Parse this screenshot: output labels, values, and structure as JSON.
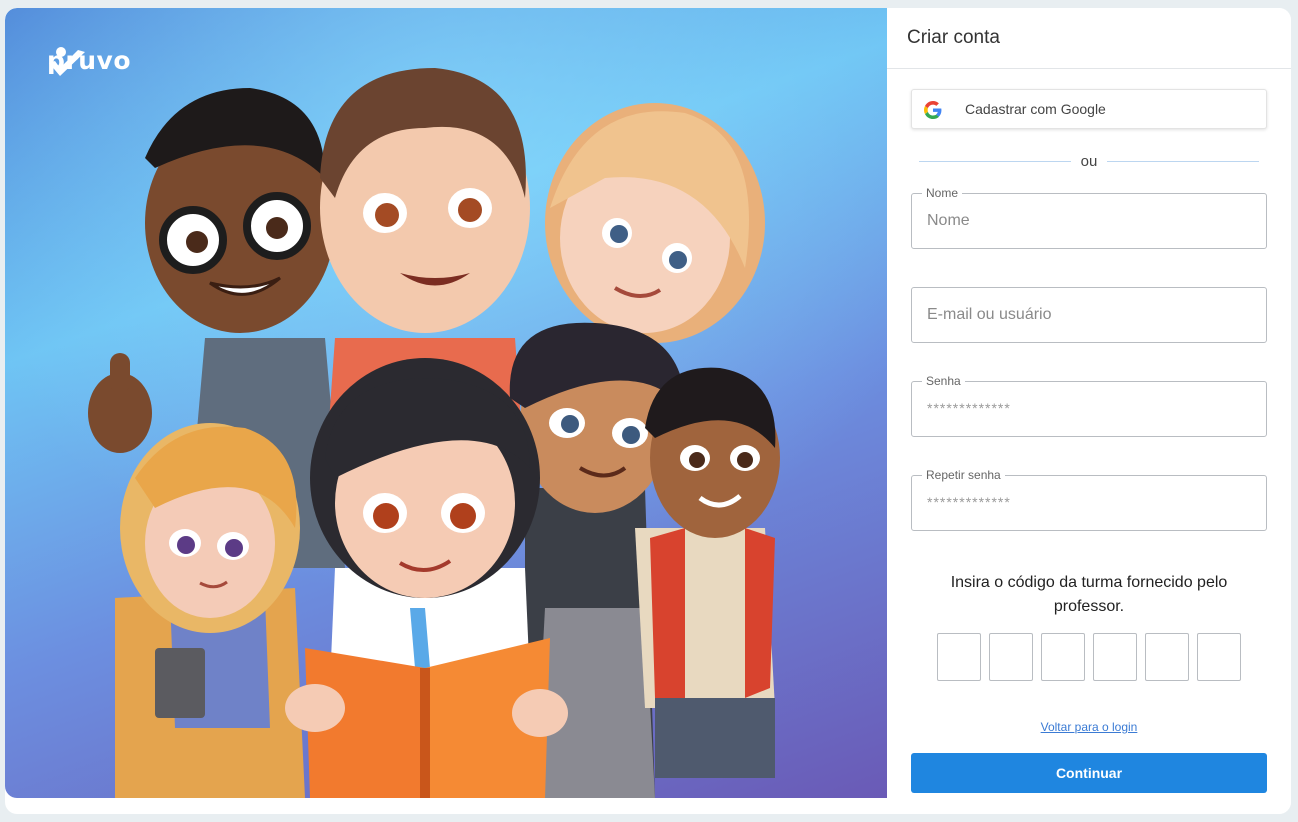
{
  "brand": {
    "name": "pruvo"
  },
  "panel": {
    "title": "Criar conta",
    "google_label": "Cadastrar com Google",
    "divider_text": "ou",
    "fields": {
      "name": {
        "legend": "Nome",
        "placeholder": "Nome"
      },
      "email": {
        "placeholder": "E-mail ou usuário"
      },
      "password": {
        "legend": "Senha",
        "placeholder": "*************"
      },
      "repeat_password": {
        "legend": "Repetir senha",
        "placeholder": "*************"
      }
    },
    "class_code_instruction": "Insira o código da turma fornecido pelo professor.",
    "back_to_login": "Voltar para o login",
    "continue_label": "Continuar"
  },
  "colors": {
    "primary": "#1f86e0",
    "link": "#3b7bd4",
    "hero_top": "#6ec4f4",
    "hero_bottom": "#6a5ab6"
  }
}
